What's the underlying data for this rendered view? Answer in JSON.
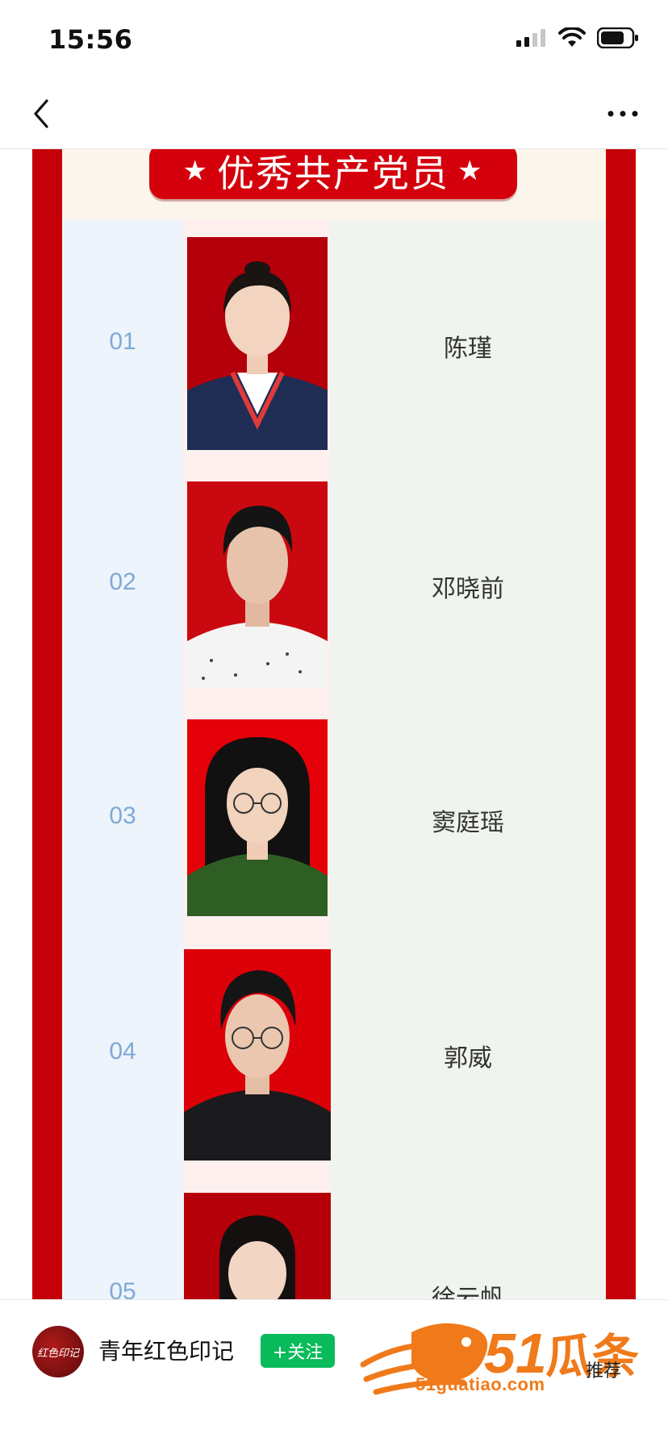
{
  "status_bar": {
    "time": "15:56"
  },
  "article": {
    "banner_title": "优秀共产党员",
    "banner_star": "★",
    "rows": [
      {
        "number": "01",
        "name": "陈瑾"
      },
      {
        "number": "02",
        "name": "邓晓前"
      },
      {
        "number": "03",
        "name": "窦庭瑶"
      },
      {
        "number": "04",
        "name": "郭威"
      },
      {
        "number": "05",
        "name": "徐云帆"
      }
    ]
  },
  "bottom_bar": {
    "avatar_text": "红色印记",
    "account_name": "青年红色印记",
    "follow_label": "+关注",
    "recommend_label": "推荐"
  },
  "watermark": {
    "logo_text": "51瓜条",
    "domain": "51guatiao.com"
  },
  "colors": {
    "frame_red": "#c50008",
    "banner_red": "#d4000c",
    "number_blue": "#7ea9d6",
    "follow_green": "#09bb5a",
    "watermark_orange": "#f07a1a"
  }
}
